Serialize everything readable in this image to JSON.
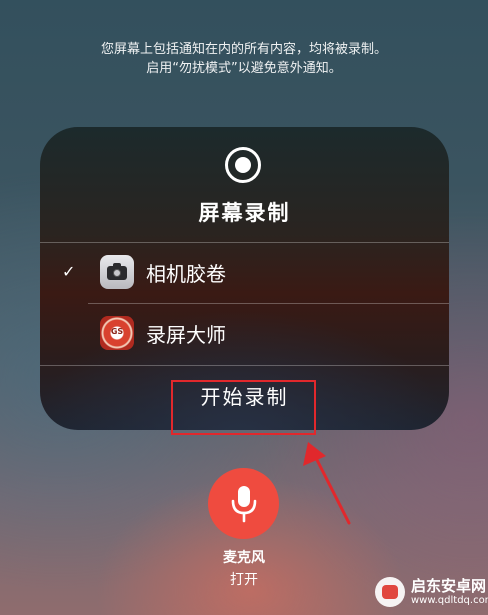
{
  "notice": {
    "line1": "您屏幕上包括通知在内的所有内容，均将被录制。",
    "line2": "启用“勿扰模式”以避免意外通知。"
  },
  "panel": {
    "title": "屏幕录制",
    "options": [
      {
        "label": "相机胶卷",
        "checked": true,
        "check_glyph": "✓",
        "icon": "camera-app-icon"
      },
      {
        "label": "录屏大师",
        "checked": false,
        "check_glyph": "",
        "icon": "screen-master-app-icon",
        "icon_text": "GS"
      }
    ],
    "start_label": "开始录制"
  },
  "microphone": {
    "label": "麦克风",
    "state": "打开",
    "icon": "microphone-icon"
  },
  "annotation": {
    "highlight_color": "#e1282c"
  },
  "watermark": {
    "name": "启东安卓网",
    "url": "www.qdltdq.com"
  }
}
